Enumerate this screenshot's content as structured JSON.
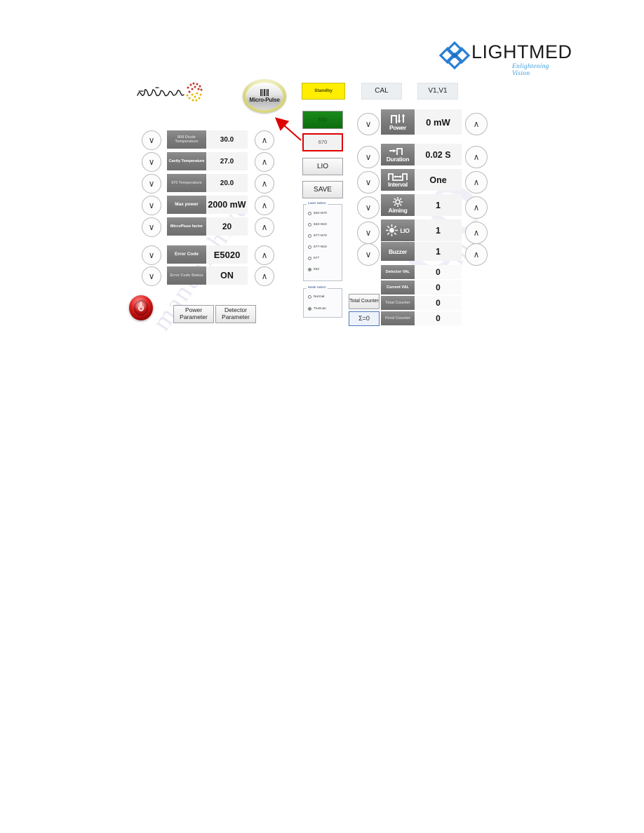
{
  "logo": {
    "brand": "LIGHTMED",
    "tagline": "Enlightening Vision",
    "mark_icon": "interlocking-diamond-icon",
    "color": "#2a7fd4"
  },
  "watermark": {
    "line_a": "manualshive",
    "line_b": "co",
    "line_c": "m"
  },
  "panel": {
    "truscan_logo": "TruScan",
    "micropulse": {
      "label": "Micro-Pulse",
      "icon": "pulse-train-icon"
    },
    "top_buttons": [
      {
        "label": "Standby",
        "style": "yellow"
      },
      {
        "label": "CAL",
        "style": "flat"
      },
      {
        "label": "V1,V1",
        "style": "flat"
      }
    ],
    "left_params": [
      {
        "tag": "808 Diode Temperature",
        "value": "30.0",
        "dim": true
      },
      {
        "tag": "Cavity Temperature",
        "value": "27.0",
        "dim": false
      },
      {
        "tag": "670 Temperature",
        "value": "20.0",
        "dim": true
      },
      {
        "tag": "Max  power",
        "value": "2000 mW",
        "dim": false
      },
      {
        "tag": "MircoPluse factor",
        "value": "20",
        "dim": false
      }
    ],
    "error_params": [
      {
        "tag": "Error Code",
        "value": "E5020"
      },
      {
        "tag": "Error Code Status",
        "value": "ON"
      }
    ],
    "laser_buttons": [
      {
        "label": "532",
        "style": "green"
      },
      {
        "label": "670",
        "style": "redbox"
      },
      {
        "label": "LIO",
        "style": "plain"
      },
      {
        "label": "SAVE",
        "style": "plain"
      }
    ],
    "laser_select": {
      "legend": "Laser Select",
      "options": [
        {
          "label": "532+670",
          "selected": false
        },
        {
          "label": "532+810",
          "selected": false
        },
        {
          "label": "577+670",
          "selected": false
        },
        {
          "label": "577+810",
          "selected": false
        },
        {
          "label": "577",
          "selected": false
        },
        {
          "label": "532",
          "selected": true
        }
      ]
    },
    "mode_select": {
      "legend": "Mode Select",
      "options": [
        {
          "label": "Normal",
          "selected": false
        },
        {
          "label": "TruScan",
          "selected": true
        }
      ]
    },
    "right_params": [
      {
        "tag": "Power",
        "value": "0 mW",
        "icon": "power-pulse-icon"
      },
      {
        "tag": "Duration",
        "value": "0.02  S",
        "icon": "duration-pulse-icon"
      },
      {
        "tag": "Interval",
        "value": "One",
        "icon": "interval-pulse-icon"
      },
      {
        "tag": "Aiming",
        "value": "1",
        "icon": "crosshair-icon"
      },
      {
        "tag": "LIO",
        "value": "1",
        "icon": "sun-icon"
      },
      {
        "tag": "Buzzer",
        "value": "1",
        "icon": "none"
      }
    ],
    "counters": [
      {
        "tag": "Detector VAL",
        "value": "0"
      },
      {
        "tag": "Current VAL",
        "value": "0"
      },
      {
        "tag": "Total Counter",
        "value": "0"
      },
      {
        "tag": "Fired Counter",
        "value": "0"
      }
    ],
    "counter_buttons": [
      {
        "label": "Total Counter"
      },
      {
        "label": "Σ=0"
      }
    ],
    "bottom_buttons": [
      {
        "label": "Power Parameter"
      },
      {
        "label": "Detector Parameter"
      }
    ],
    "power_button_icon": "power-icon",
    "annotation_arrow": {
      "color": "#e00000",
      "points_from": "670",
      "points_to": "micro-pulse-badge"
    },
    "arrow_down_glyph": "∨",
    "arrow_up_glyph": "∧"
  }
}
